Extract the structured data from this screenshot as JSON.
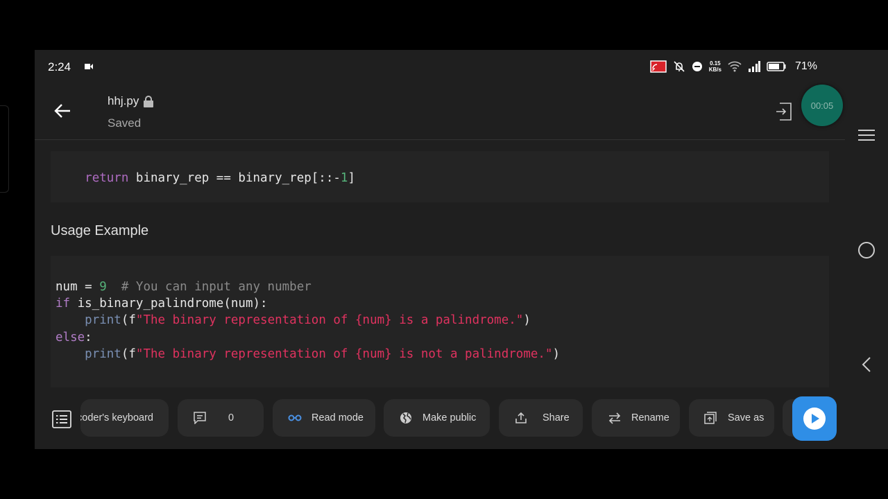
{
  "status_bar": {
    "time": "2:24",
    "data_rate_top": "0.15",
    "data_rate_bottom": "KB/s",
    "battery": "71%"
  },
  "header": {
    "file_name": "hhj.py",
    "status": "Saved",
    "timer": "00:05"
  },
  "code_block_1": {
    "indent": "    ",
    "kw_return": "return",
    "line_mid": " binary_rep == binary_rep[::-",
    "num_1": "1",
    "line_end": "]"
  },
  "section_heading": "Usage Example",
  "code_block_2": {
    "l1_a": "num = ",
    "l1_num": "9",
    "l1_comment": "  # You can input any number",
    "l2_kw": "if",
    "l2_rest": " is_binary_palindrome(num):",
    "l3_indent": "    ",
    "l3_fn": "print",
    "l3_a": "(f",
    "l3_str": "\"The binary representation of {num} is a palindrome.\"",
    "l3_end": ")",
    "l4_kw": "else",
    "l4_rest": ":",
    "l5_indent": "    ",
    "l5_fn": "print",
    "l5_a": "(f",
    "l5_str": "\"The binary representation of {num} is not a palindrome.\"",
    "l5_end": ")"
  },
  "toolbar": {
    "keyboard_label": "coder's keyboard",
    "comment_count": "0",
    "read_mode": "Read mode",
    "make_public": "Make public",
    "share": "Share",
    "rename": "Rename",
    "save_as": "Save as"
  },
  "colors": {
    "background": "#1f1f1f",
    "code_bg": "#242424",
    "accent": "#2f8ee6",
    "string": "#e0325f",
    "timer_bg": "#0f6b5a"
  }
}
